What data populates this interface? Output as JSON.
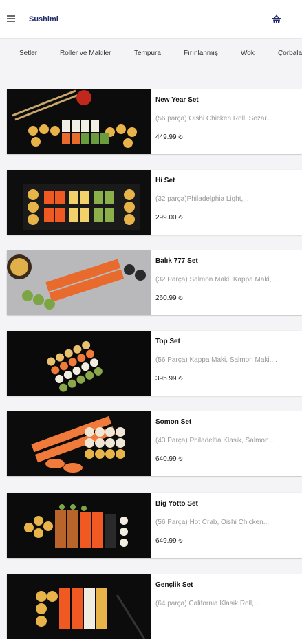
{
  "app": {
    "title": "Sushimi"
  },
  "icons": {
    "menu": "menu-icon",
    "cart": "basket-icon"
  },
  "tabs": [
    "Setler",
    "Roller ve Makiler",
    "Tempura",
    "Fırınlanmış",
    "Wok",
    "Çorbalar"
  ],
  "products": [
    {
      "name": "New Year Set",
      "description": "(56 parça) Oishi Chicken Roll, Sezar...",
      "price": "449.99 ₺"
    },
    {
      "name": "Hi Set",
      "description": "(32 parça)Philadelphia Light,...",
      "price": "299.00 ₺"
    },
    {
      "name": "Balık 777 Set",
      "description": "(32 Parça) Salmon Maki, Kappa Maki,...",
      "price": "260.99 ₺"
    },
    {
      "name": "Top Set",
      "description": "(56 Parça) Kappa Maki, Salmon Maki,...",
      "price": "395.99 ₺"
    },
    {
      "name": "Somon Set",
      "description": "(43 Parça) Philadelfia Klasik, Salmon...",
      "price": "640.99 ₺"
    },
    {
      "name": "Big Yotto Set",
      "description": "(56 Parça) Hot Crab, Oishi Chicken...",
      "price": "649.99 ₺"
    },
    {
      "name": "Gençlik Set",
      "description": "(64 parça) California Klasik Roll,...",
      "price": ""
    }
  ],
  "colors": {
    "title": "#1f2a6b",
    "background": "#f4f4f6"
  }
}
